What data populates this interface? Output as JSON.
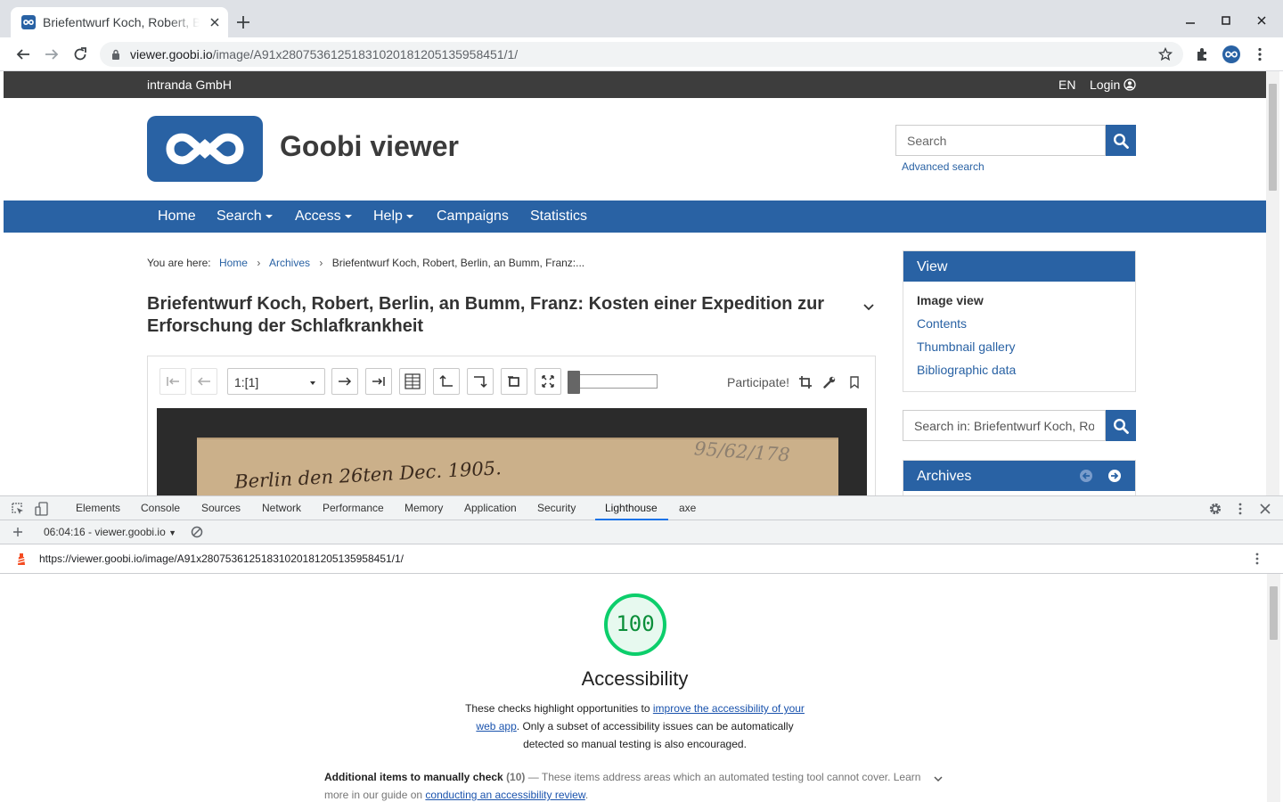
{
  "browser": {
    "tab_title": "Briefentwurf Koch, Robert, Berlin, an Bumm, Franz: Kosten einer Expedition zur Erforschung der Schlafkrankheit",
    "url_host": "viewer.goobi.io",
    "url_path": "/image/A91x28075361251831020181205135958451/1/"
  },
  "site": {
    "org": "intranda GmbH",
    "lang": "EN",
    "login": "Login",
    "brand": "Goobi viewer",
    "search_placeholder": "Search",
    "advanced_search": "Advanced search",
    "nav": [
      {
        "label": "Home",
        "dropdown": false
      },
      {
        "label": "Search",
        "dropdown": true
      },
      {
        "label": "Access",
        "dropdown": true
      },
      {
        "label": "Help",
        "dropdown": true
      },
      {
        "label": "Campaigns",
        "dropdown": false
      },
      {
        "label": "Statistics",
        "dropdown": false
      }
    ],
    "accent": "#2962a4"
  },
  "breadcrumb": {
    "prefix": "You are here:",
    "items": [
      "Home",
      "Archives"
    ],
    "current": "Briefentwurf Koch, Robert, Berlin, an Bumm, Franz:..."
  },
  "document": {
    "title": "Briefentwurf Koch, Robert, Berlin, an Bumm, Franz: Kosten einer Expedition zur Erforschung der Schlafkrankheit",
    "page_select": "1:[1]",
    "participate": "Participate!",
    "zoom_fraction": 0.05,
    "handwriting_1": "Berlin den 26ten Dec. 1905.",
    "handwriting_2": "95/62/178"
  },
  "sidebar": {
    "view_title": "View",
    "view_items": [
      {
        "label": "Image view",
        "active": true
      },
      {
        "label": "Contents",
        "active": false
      },
      {
        "label": "Thumbnail gallery",
        "active": false
      },
      {
        "label": "Bibliographic data",
        "active": false
      }
    ],
    "search_in_placeholder": "Search in: Briefentwurf Koch, Ro",
    "archives_title": "Archives"
  },
  "devtools": {
    "tabs": [
      "Elements",
      "Console",
      "Sources",
      "Network",
      "Performance",
      "Memory",
      "Application",
      "Security",
      "Lighthouse",
      "axe"
    ],
    "active_tab": "Lighthouse",
    "report_select": "06:04:16 - viewer.goobi.io",
    "report_url": "https://viewer.goobi.io/image/A91x28075361251831020181205135958451/1/"
  },
  "lighthouse": {
    "score": "100",
    "score_color": "#0cce6b",
    "category": "Accessibility",
    "desc_before": "These checks highlight opportunities to ",
    "desc_link": "improve the accessibility of your web app",
    "desc_after": ". Only a subset of accessibility issues can be automatically detected so manual testing is also encouraged.",
    "manual_title": "Additional items to manually check",
    "manual_count": "(10)",
    "manual_dash": " — ",
    "manual_text": "These items address areas which an automated testing tool cannot cover. Learn more in our guide on ",
    "manual_link": "conducting an accessibility review",
    "manual_end": "."
  }
}
